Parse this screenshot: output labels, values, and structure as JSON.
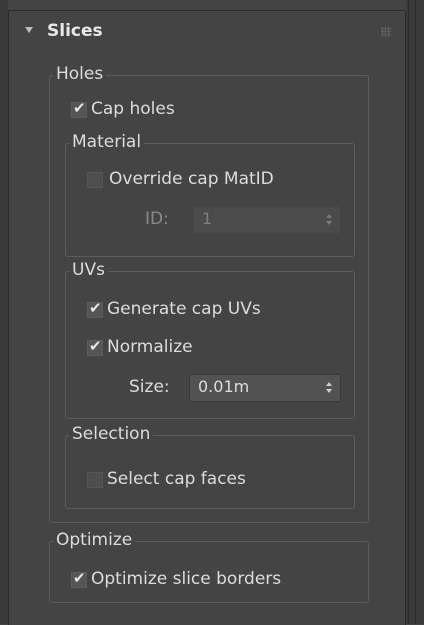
{
  "rollout": {
    "title": "Slices"
  },
  "holes": {
    "title": "Holes",
    "cap_holes": {
      "label": "Cap holes",
      "checked": true
    },
    "material": {
      "title": "Material",
      "override": {
        "label": "Override cap MatID",
        "checked": false
      },
      "id": {
        "label": "ID:",
        "value": "1"
      }
    },
    "uvs": {
      "title": "UVs",
      "generate": {
        "label": "Generate cap UVs",
        "checked": true
      },
      "normalize": {
        "label": "Normalize",
        "checked": true
      },
      "size": {
        "label": "Size:",
        "value": "0.01m"
      }
    },
    "selection": {
      "title": "Selection",
      "select_faces": {
        "label": "Select cap faces",
        "checked": false
      }
    }
  },
  "optimize": {
    "title": "Optimize",
    "optimize_borders": {
      "label": "Optimize slice borders",
      "checked": true
    }
  }
}
